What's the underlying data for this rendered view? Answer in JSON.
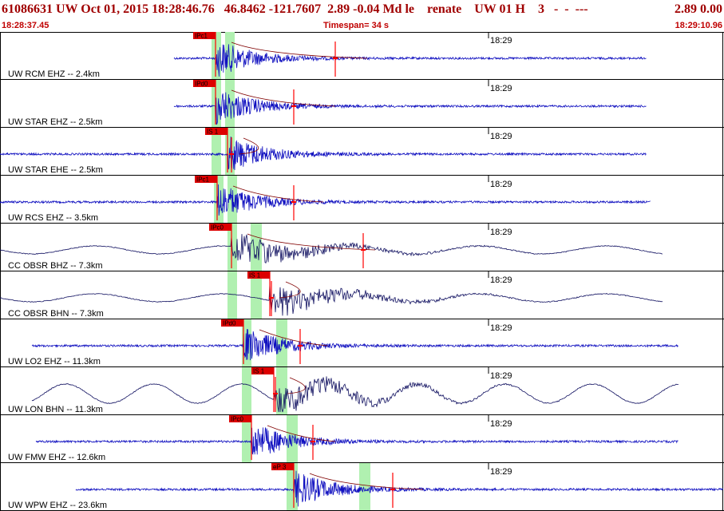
{
  "header": {
    "title": "61086631 UW Oct 01, 2015 18:28:46.76   46.8462 -121.7607  2.89 -0.04 Md le    renate    UW 01 H    3   -  -  ---",
    "title_right": "2.89 0.00",
    "start_time": "18:28:37.45",
    "timespan": "Timespan=  34 s",
    "end_time": "18:29:10.96"
  },
  "colors": {
    "trace": "#1010c0",
    "trace_lp": "#101060",
    "pick_line": "#ff0000",
    "pick_box": "#dd0000",
    "window": "#b0f0b0",
    "text": "#000000",
    "header_text": "#a00000"
  },
  "channels": [
    {
      "label": "UW RCM EHZ -- 2.4km",
      "tick": "18:29",
      "pick": "IPc1",
      "kind": "hf"
    },
    {
      "label": "UW STAR EHZ -- 2.5km",
      "tick": "18:29",
      "pick": "IPd0",
      "kind": "hf"
    },
    {
      "label": "UW STAR EHE -- 2.5km",
      "tick": "18:29",
      "pick": "IS 1",
      "kind": "hf"
    },
    {
      "label": "UW RCS EHZ -- 3.5km",
      "tick": "18:29",
      "pick": "IPc1",
      "kind": "hf"
    },
    {
      "label": "CC OBSR BHZ -- 7.3km",
      "tick": "18:29",
      "pick": "IPc0",
      "kind": "lp"
    },
    {
      "label": "CC OBSR BHN -- 7.3km",
      "tick": "18:29",
      "pick": "IS 1",
      "kind": "lp"
    },
    {
      "label": "UW LO2 EHZ -- 11.3km",
      "tick": "18:29",
      "pick": "IPd0",
      "kind": "hf"
    },
    {
      "label": "UW LON BHN -- 11.3km",
      "tick": "18:29",
      "pick": "IS 1",
      "kind": "lp"
    },
    {
      "label": "UW FMW EHZ -- 12.6km",
      "tick": "18:29",
      "pick": "IPc0",
      "kind": "hf"
    },
    {
      "label": "UW WPW EHZ -- 23.6km",
      "tick": "18:29",
      "pick": "eP 3",
      "kind": "hf"
    }
  ]
}
